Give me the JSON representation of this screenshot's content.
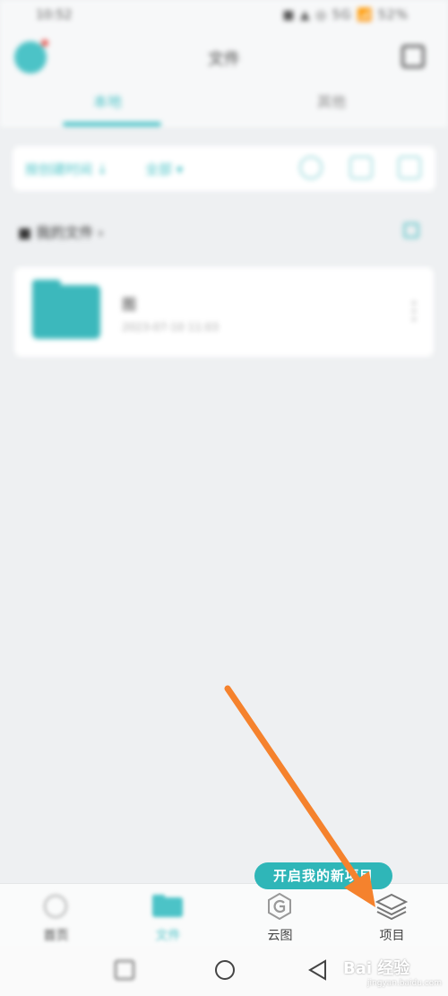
{
  "status_bar": {
    "time": "10:52",
    "right": "■ ▲ ◎ 5G 📶 52%"
  },
  "header": {
    "title": "文件"
  },
  "tabs": [
    {
      "label": "本地",
      "active": true
    },
    {
      "label": "其他",
      "active": false
    }
  ],
  "toolbar": {
    "sort_label": "按创建时间 ↓",
    "filter_label": "全部 ▾"
  },
  "section": {
    "title": "■ 我的文件 ›"
  },
  "files": [
    {
      "name": "图",
      "date": "2023-07-10 11:03"
    }
  ],
  "bottom_nav": {
    "items": [
      {
        "label": "首页"
      },
      {
        "label": "文件",
        "active": true
      },
      {
        "label": "云图"
      },
      {
        "label": "项目"
      }
    ]
  },
  "badge": {
    "text": "开启我的新项目"
  },
  "watermark": {
    "brand": "Bai 经验",
    "sub": "jingyan.baidu.com"
  },
  "colors": {
    "accent": "#4cc3c7",
    "arrow": "#f5822d",
    "badge": "#2fb6b8"
  },
  "icons": {
    "home": "home-icon",
    "files": "folder-icon",
    "cloud": "cloud-g-icon",
    "project": "layers-icon",
    "search": "search-icon",
    "sys_square": "recent-apps-icon",
    "sys_home": "home-circle-icon",
    "sys_back": "back-triangle-icon"
  }
}
